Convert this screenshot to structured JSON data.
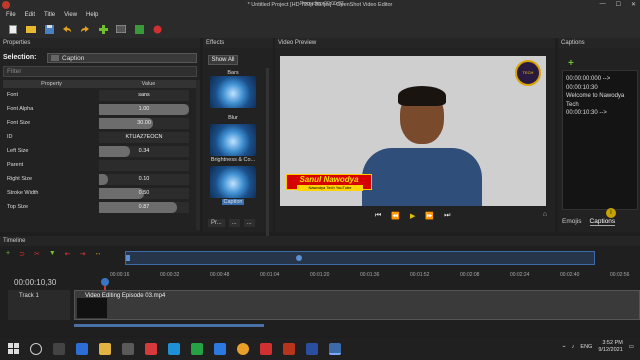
{
  "window": {
    "title": "* Untitled Project [HD 720p 30 fps] - OpenShot Video Editor",
    "recording_label": "Recording 00:00:03",
    "min": "—",
    "max": "☐",
    "close": "✕"
  },
  "menu": [
    "File",
    "Edit",
    "Title",
    "View",
    "Help"
  ],
  "toolbar_icons": [
    "new-icon",
    "open-icon",
    "save-icon",
    "undo-icon",
    "redo-icon",
    "import-icon",
    "profile-icon",
    "export-icon",
    "record-icon"
  ],
  "properties": {
    "title": "Properties",
    "selection_label": "Selection:",
    "selection_value": "Caption",
    "filter_placeholder": "Filter",
    "col_property": "Property",
    "col_value": "Value",
    "rows": [
      {
        "name": "Font",
        "value": "sans",
        "fill": 0
      },
      {
        "name": "Font Alpha",
        "value": "1.00",
        "fill": 1.0
      },
      {
        "name": "Font Size",
        "value": "30.00",
        "fill": 0.6
      },
      {
        "name": "ID",
        "value": "KTUAZ7EOCN",
        "fill": 0
      },
      {
        "name": "Left Size",
        "value": "0.34",
        "fill": 0.34
      },
      {
        "name": "Parent",
        "value": "",
        "fill": 0
      },
      {
        "name": "Right Size",
        "value": "0.10",
        "fill": 0.1
      },
      {
        "name": "Stroke Width",
        "value": "0.50",
        "fill": 0.5
      },
      {
        "name": "Top Size",
        "value": "0.87",
        "fill": 0.87
      }
    ]
  },
  "effects": {
    "title": "Effects",
    "show_all": "Show All",
    "items": [
      "Bars",
      "Blur",
      "Brightness & Co...",
      "Caption"
    ],
    "tabs": [
      "Pr...",
      "...",
      "..."
    ]
  },
  "preview": {
    "title": "Video Preview",
    "lower_third_name": "Sanul Nawodya",
    "lower_third_sub": "Nawodya Tech YouTube",
    "logo_text": "TECH",
    "controls": [
      "⏮",
      "⏪",
      "▶",
      "⏩",
      "⏭"
    ]
  },
  "captions": {
    "title": "Captions",
    "lines": [
      "00:00:00:000 -->",
      "00:00:10:30",
      "Welcome to Nawodya Tech",
      "00:00:10:30 -->"
    ],
    "tabs": [
      "Emojis",
      "Captions"
    ],
    "cursor_label": "I"
  },
  "timeline": {
    "title": "Timeline",
    "timecode": "00:00:10,30",
    "ticks": [
      "00:00:16",
      "00:00:32",
      "00:00:48",
      "00:01:04",
      "00:01:20",
      "00:01:36",
      "00:01:52",
      "00:02:08",
      "00:02:24",
      "00:02:40",
      "00:02:56"
    ],
    "track_name": "Track 1",
    "clip_name": "Video Editing Episode 03.mp4"
  },
  "taskbar": {
    "lang": "ENG",
    "time": "3:52 PM",
    "date": "9/12/2021"
  },
  "colors": {
    "accent": "#3a75c4",
    "add_green": "#6fbf2f",
    "playhead_red": "#c0392b"
  }
}
